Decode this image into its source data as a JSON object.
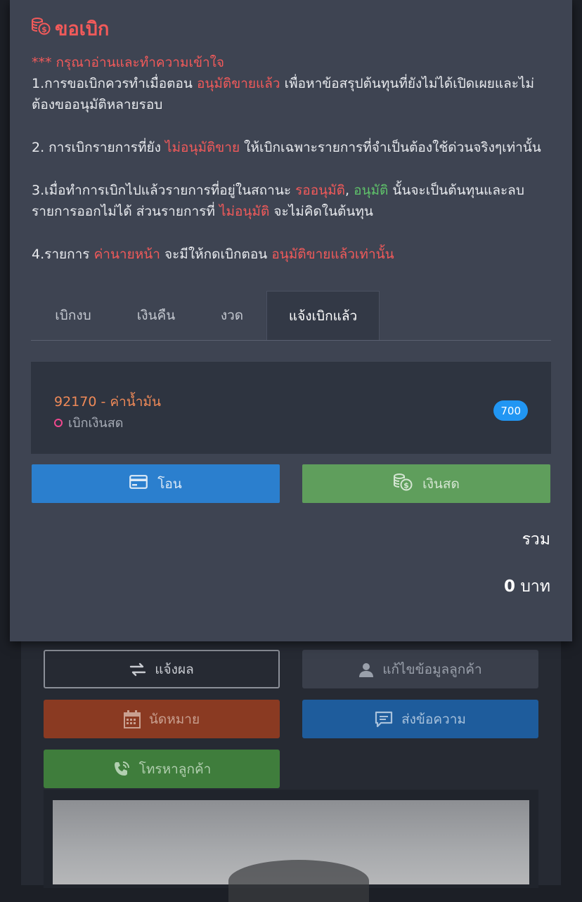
{
  "modal": {
    "title": "ขอเบิก",
    "notice": {
      "heading": "*** กรุณาอ่านและทำความเข้าใจ",
      "p1_a": "1.การขอเบิกควรทำเมื่อตอน ",
      "p1_hl": "อนุมัติขายแล้ว",
      "p1_b": " เพื่อหาข้อสรุปต้นทุนที่ยังไม่ได้เปิดเผยและไม่ต้องขออนุมัติหลายรอบ",
      "p2_a": "2. การเบิกรายการที่ยัง ",
      "p2_hl": "ไม่อนุมัติขาย",
      "p2_b": " ให้เบิกเฉพาะรายการที่จำเป็นต้องใช้ด่วนจริงๆเท่านั้น",
      "p3_a": "3.เมื่อทำการเบิกไปแล้วรายการที่อยู่ในสถานะ ",
      "p3_hl1": "รออนุมัติ",
      "p3_sep": ", ",
      "p3_hl2": "อนุมัติ",
      "p3_b": " นั้นจะเป็นต้นทุนและลบรายการออกไม่ได้ ส่วนรายการที่ ",
      "p3_hl3": "ไม่อนุมัติ",
      "p3_c": " จะไม่คิดในต้นทุน",
      "p4_a": "4.รายการ ",
      "p4_hl1": "ค่านายหน้า",
      "p4_b": " จะมีให้กดเบิกตอน ",
      "p4_hl2": "อนุมัติขายแล้วเท่านั้น"
    },
    "tabs": [
      {
        "label": "เบิกงบ"
      },
      {
        "label": "เงินคืน"
      },
      {
        "label": "งวด"
      },
      {
        "label": "แจ้งเบิกแล้ว"
      }
    ],
    "active_tab": "แจ้งเบิกแล้ว",
    "item": {
      "title": "92170 - ค่าน้ำมัน",
      "status": "เบิกเงินสด",
      "amount": "700"
    },
    "buttons": {
      "transfer": "โอน",
      "cash": "เงินสด"
    },
    "total_label": "รวม",
    "total_value": "0",
    "total_unit": "บาท"
  },
  "background": {
    "report": "แจ้งผล",
    "edit_customer": "แก้ไขข้อมูลลูกค้า",
    "appointment": "นัดหมาย",
    "send_message": "ส่งข้อความ",
    "call_customer": "โทรหาลูกค้า"
  },
  "colors": {
    "accent_red": "#f25a5a",
    "accent_green": "#5fc26a",
    "badge_blue": "#2196f3",
    "transfer_blue": "#2b7fce",
    "cash_green": "#5f9e5c"
  },
  "icons": {
    "title": "money-coins-icon",
    "transfer": "credit-card-icon",
    "cash": "money-coins-icon",
    "report": "swap-arrows-icon",
    "edit_customer": "user-icon",
    "appointment": "calendar-icon",
    "send_message": "chat-icon",
    "call_customer": "phone-ring-icon"
  }
}
